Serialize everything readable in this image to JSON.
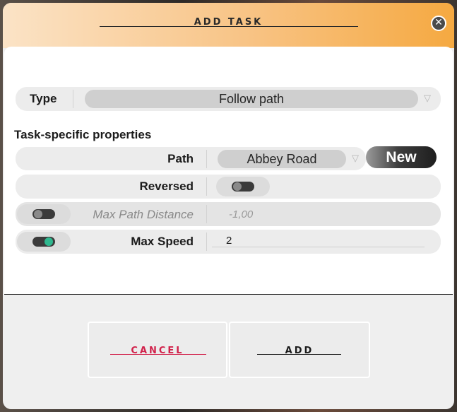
{
  "dialog": {
    "title": "ADD TASK"
  },
  "type_row": {
    "label": "Type",
    "value": "Follow path"
  },
  "section": {
    "title": "Task-specific properties"
  },
  "path_row": {
    "label": "Path",
    "value": "Abbey Road",
    "new_label": "New"
  },
  "reversed_row": {
    "label": "Reversed",
    "toggle_on": false
  },
  "max_path_distance_row": {
    "label": "Max Path Distance",
    "value": "-1,00",
    "enabled": false
  },
  "max_speed_row": {
    "label": "Max Speed",
    "value": "2",
    "enabled": true
  },
  "footer": {
    "cancel_label": "CANCEL",
    "add_label": "ADD"
  },
  "colors": {
    "accent_orange": "#f5a941",
    "cancel_red": "#d1224b",
    "toggle_on": "#2fb88f"
  },
  "icons": {
    "close": "close-icon",
    "dropdown": "chevron-down-icon"
  }
}
